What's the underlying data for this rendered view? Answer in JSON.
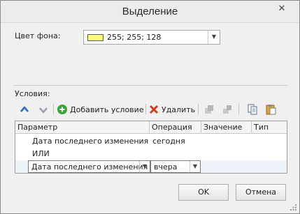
{
  "window": {
    "title": "Выделение",
    "close_glyph": "✕"
  },
  "background": {
    "label": "Цвет фона:",
    "value": "255; 255; 128",
    "swatch_color": "#ffff80"
  },
  "conditions": {
    "label": "Условия:",
    "toolbar": {
      "move_up_icon": "arrow-up",
      "move_down_icon": "arrow-down",
      "add_label": "Добавить условие",
      "delete_label": "Удалить",
      "group_icon": "group",
      "ungroup_icon": "ungroup",
      "copy_icon": "copy",
      "paste_icon": "paste"
    },
    "columns": [
      "Параметр",
      "Операция",
      "Значение",
      "Тип"
    ],
    "rows": [
      {
        "parameter": "Дата последнего изменения",
        "operation": "сегодня",
        "value": "",
        "type": ""
      },
      {
        "parameter": "ИЛИ",
        "operation": "",
        "value": "",
        "type": ""
      },
      {
        "parameter": "Дата последнего изменения",
        "operation": "вчера",
        "value": "",
        "type": "",
        "editing": true
      }
    ]
  },
  "buttons": {
    "ok": "OK",
    "cancel": "Отмена"
  }
}
